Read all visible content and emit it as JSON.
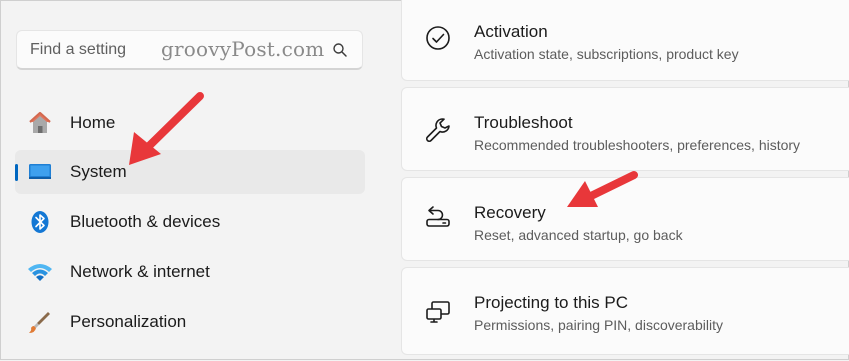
{
  "search": {
    "placeholder": "Find a setting",
    "watermark": "groovyPost.com"
  },
  "sidebar": {
    "items": [
      {
        "label": "Home",
        "icon": "home-icon",
        "selected": false
      },
      {
        "label": "System",
        "icon": "system-icon",
        "selected": true
      },
      {
        "label": "Bluetooth & devices",
        "icon": "bluetooth-icon",
        "selected": false
      },
      {
        "label": "Network & internet",
        "icon": "wifi-icon",
        "selected": false
      },
      {
        "label": "Personalization",
        "icon": "paintbrush-icon",
        "selected": false
      }
    ]
  },
  "main": {
    "cards": [
      {
        "title": "Activation",
        "description": "Activation state, subscriptions, product key",
        "icon": "activation-check-icon"
      },
      {
        "title": "Troubleshoot",
        "description": "Recommended troubleshooters, preferences, history",
        "icon": "wrench-icon"
      },
      {
        "title": "Recovery",
        "description": "Reset, advanced startup, go back",
        "icon": "recovery-icon"
      },
      {
        "title": "Projecting to this PC",
        "description": "Permissions, pairing PIN, discoverability",
        "icon": "projecting-icon"
      }
    ]
  },
  "colors": {
    "accent": "#0067c0",
    "annotation_arrow": "#e8373a"
  }
}
